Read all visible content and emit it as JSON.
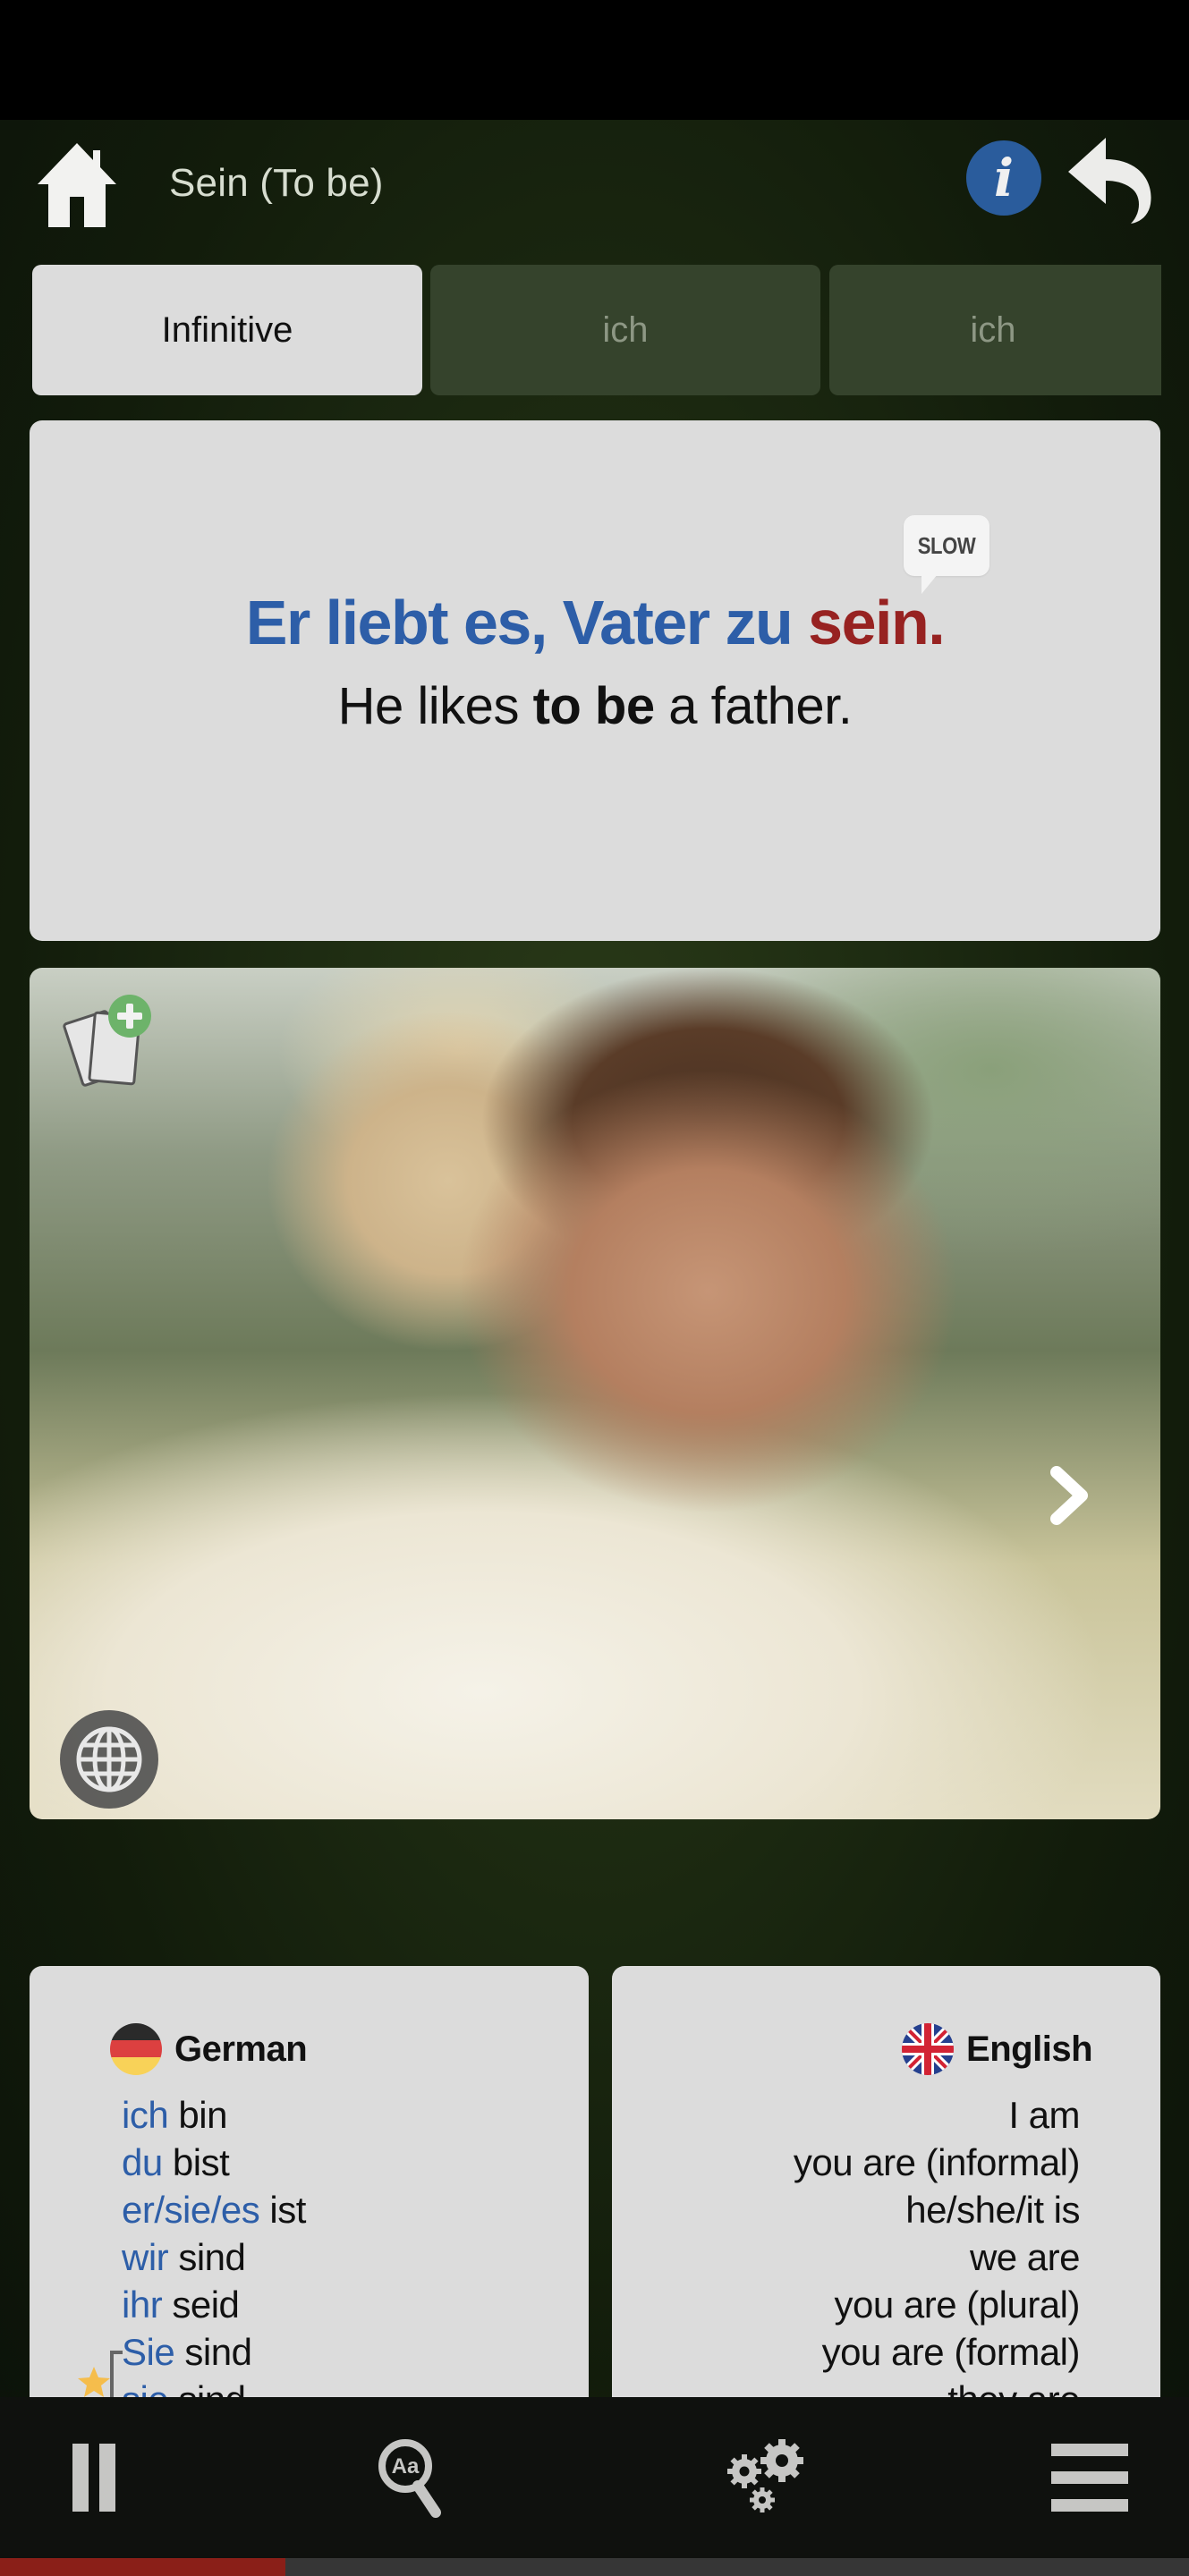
{
  "header": {
    "title": "Sein (To be)",
    "info_icon_glyph": "i",
    "icons": [
      "home-icon",
      "info-icon",
      "back-icon"
    ]
  },
  "tabs": [
    {
      "label": "Infinitive",
      "active": true
    },
    {
      "label": "ich",
      "active": false
    },
    {
      "label": "ich",
      "active": false
    }
  ],
  "sentence": {
    "slow_label": "SLOW",
    "german_prefix": "Er liebt es, Vater zu ",
    "german_highlight": "sein",
    "german_suffix": ".",
    "english_prefix": "He likes ",
    "english_highlight": "to be",
    "english_suffix": " a father."
  },
  "photo": {
    "description": "Smiling man giving a boy a piggyback ride outdoors",
    "icons": [
      "add-flashcard-icon",
      "chevron-right-icon",
      "globe-icon"
    ]
  },
  "conjugation": {
    "german": {
      "title": "German",
      "rows": [
        {
          "pronoun": "ich",
          "verb": "bin"
        },
        {
          "pronoun": "du",
          "verb": "bist"
        },
        {
          "pronoun": "er/sie/es",
          "verb": "ist"
        },
        {
          "pronoun": "wir",
          "verb": "sind"
        },
        {
          "pronoun": "ihr",
          "verb": "seid"
        },
        {
          "pronoun": "Sie",
          "verb": "sind"
        },
        {
          "pronoun": "sie",
          "verb": "sind"
        }
      ]
    },
    "english": {
      "title": "English",
      "rows": [
        "I am",
        "you are (informal)",
        "he/she/it is",
        "we are",
        "you are (plural)",
        "you are (formal)",
        "they are"
      ]
    }
  },
  "bottom_nav": {
    "icons": [
      "pause-icon",
      "dictionary-search-icon",
      "settings-gears-icon",
      "menu-icon"
    ],
    "search_icon_text": "Aa"
  },
  "progress": {
    "fraction": 0.24
  },
  "colors": {
    "accent_blue": "#2d5ea8",
    "highlight_red": "#972221",
    "progress_red": "#8a1f18",
    "info_blue": "#2a5c9c",
    "flashcard_green": "#6db36a",
    "star_gold": "#f5bd4c"
  }
}
